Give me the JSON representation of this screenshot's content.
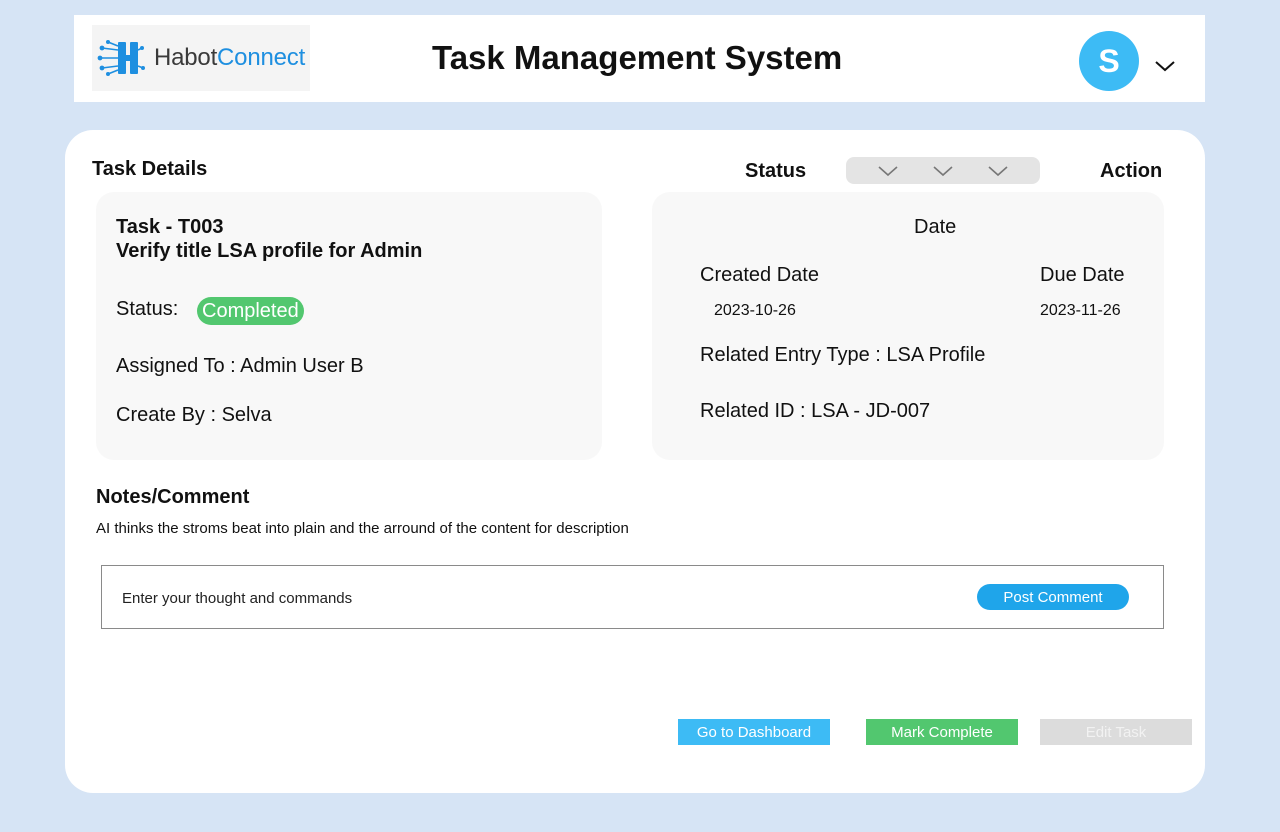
{
  "header": {
    "logo_part1": "Habot",
    "logo_part2": "Connect",
    "title": "Task Management System",
    "avatar_initial": "S"
  },
  "toolbar": {
    "task_details_label": "Task Details",
    "status_label": "Status",
    "action_label": "Action"
  },
  "task": {
    "id_line": "Task -  T003",
    "name": "Verify title LSA profile for Admin",
    "status_label": "Status:",
    "status_value": "Completed",
    "assigned_line": "Assigned To : Admin User B",
    "created_by_line": "Create By : Selva"
  },
  "dates": {
    "heading": "Date",
    "created_label": "Created Date",
    "created_value": "2023-10-26",
    "due_label": "Due Date",
    "due_value": "2023-11-26",
    "entry_type_line": "Related Entry Type   : LSA Profile",
    "related_id_line": "Related ID : LSA - JD-007"
  },
  "notes": {
    "title": "Notes/Comment",
    "text": "AI thinks the stroms beat into plain and the arround of the content for description",
    "input_placeholder": "Enter your thought and commands",
    "post_label": "Post Comment"
  },
  "actions": {
    "dashboard_label": "Go to Dashboard",
    "complete_label": "Mark Complete",
    "edit_label": "Edit Task"
  },
  "colors": {
    "background": "#d6e4f5",
    "accent_blue": "#3dbbf5",
    "post_blue": "#1fa5ea",
    "success_green": "#52c76f",
    "disabled_gray": "#dcdcdc"
  },
  "icons": [
    "habot-logo-icon",
    "chevron-down-icon"
  ]
}
